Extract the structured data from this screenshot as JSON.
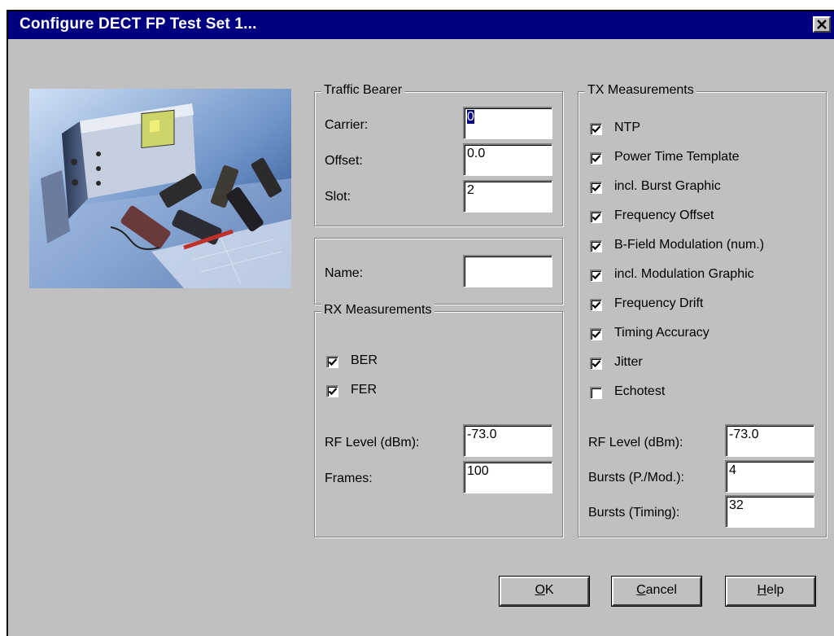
{
  "window": {
    "title": "Configure DECT FP Test Set 1...",
    "close_glyph": "✕"
  },
  "traffic_bearer": {
    "legend": "Traffic Bearer",
    "carrier_label": "Carrier:",
    "carrier_value": "0",
    "offset_label": "Offset:",
    "offset_value": "0.0",
    "slot_label": "Slot:",
    "slot_value": "2"
  },
  "name_group": {
    "label": "Name:",
    "value": ""
  },
  "rx": {
    "legend": "RX Measurements",
    "checks": [
      {
        "label": "BER",
        "checked": true
      },
      {
        "label": "FER",
        "checked": true
      }
    ],
    "rf_label": "RF Level (dBm):",
    "rf_value": "-73.0",
    "frames_label": "Frames:",
    "frames_value": "100"
  },
  "tx": {
    "legend": "TX Measurements",
    "checks": [
      {
        "label": "NTP",
        "checked": true
      },
      {
        "label": "Power Time Template",
        "checked": true
      },
      {
        "label": "incl. Burst Graphic",
        "checked": true
      },
      {
        "label": "Frequency Offset",
        "checked": true
      },
      {
        "label": "B-Field Modulation (num.)",
        "checked": true
      },
      {
        "label": "incl. Modulation Graphic",
        "checked": true
      },
      {
        "label": "Frequency Drift",
        "checked": true
      },
      {
        "label": "Timing Accuracy",
        "checked": true
      },
      {
        "label": "Jitter",
        "checked": true
      },
      {
        "label": "Echotest",
        "checked": false
      }
    ],
    "rf_label": "RF Level (dBm):",
    "rf_value": "-73.0",
    "bursts_pm_label": "Bursts (P./Mod.):",
    "bursts_pm_value": "4",
    "bursts_timing_label": "Bursts (Timing):",
    "bursts_timing_value": "32"
  },
  "buttons": {
    "ok_mnemonic": "O",
    "ok_rest": "K",
    "cancel_mnemonic": "C",
    "cancel_rest": "ancel",
    "help_mnemonic": "H",
    "help_rest": "elp"
  },
  "icons": {
    "close": "close-icon",
    "checkmark": "checkmark-icon",
    "photo": "test-equipment-photo"
  }
}
